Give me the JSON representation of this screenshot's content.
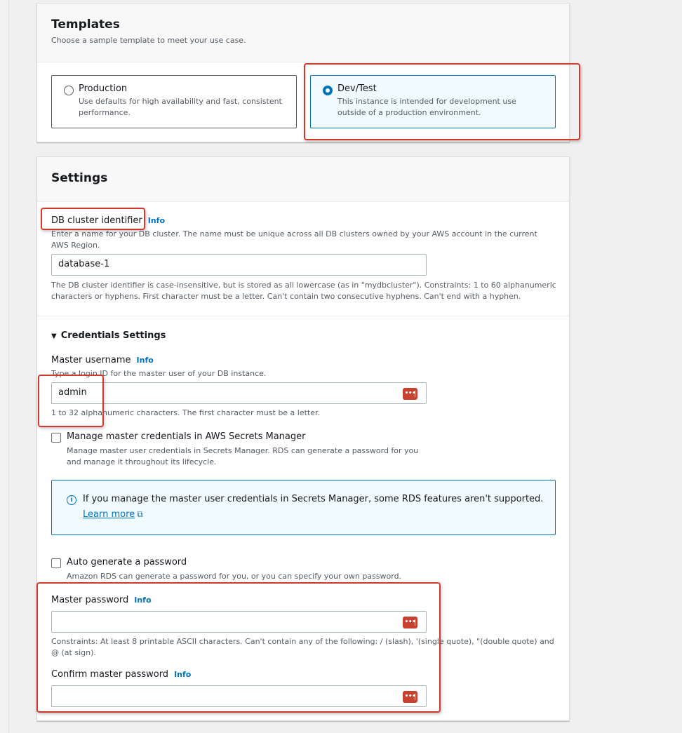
{
  "templates": {
    "title": "Templates",
    "description": "Choose a sample template to meet your use case.",
    "options": [
      {
        "label": "Production",
        "description": "Use defaults for high availability and fast, consistent performance.",
        "selected": false
      },
      {
        "label": "Dev/Test",
        "description": "This instance is intended for development use outside of a production environment.",
        "selected": true
      }
    ]
  },
  "settings": {
    "title": "Settings",
    "db_cluster_identifier": {
      "label": "DB cluster identifier",
      "info": "Info",
      "description": "Enter a name for your DB cluster. The name must be unique across all DB clusters owned by your AWS account in the current AWS Region.",
      "value": "database-1",
      "constraint": "The DB cluster identifier is case-insensitive, but is stored as all lowercase (as in \"mydbcluster\"). Constraints: 1 to 60 alphanumeric characters or hyphens. First character must be a letter. Can't contain two consecutive hyphens. Can't end with a hyphen."
    },
    "credentials": {
      "section_title": "Credentials Settings",
      "master_username": {
        "label": "Master username",
        "info": "Info",
        "description": "Type a login ID for the master user of your DB instance.",
        "value": "admin",
        "constraint": "1 to 32 alphanumeric characters. The first character must be a letter."
      },
      "manage_secrets": {
        "label": "Manage master credentials in AWS Secrets Manager",
        "description": "Manage master user credentials in Secrets Manager. RDS can generate a password for you and manage it throughout its lifecycle.",
        "checked": false
      },
      "alert": {
        "text": "If you manage the master user credentials in Secrets Manager, some RDS features aren't supported.",
        "link": "Learn more"
      },
      "auto_generate": {
        "label": "Auto generate a password",
        "description": "Amazon RDS can generate a password for you, or you can specify your own password.",
        "checked": false
      },
      "master_password": {
        "label": "Master password",
        "info": "Info",
        "value": "",
        "constraint": "Constraints: At least 8 printable ASCII characters. Can't contain any of the following: / (slash), '(single quote), \"(double quote) and @ (at sign)."
      },
      "confirm_password": {
        "label": "Confirm master password",
        "info": "Info",
        "value": ""
      }
    }
  },
  "icons": {
    "password_manager": "•••",
    "info_circle": "i",
    "external_link": "⧉",
    "caret_down": "▼"
  },
  "colors": {
    "accent": "#0073bb",
    "highlight": "#d13a2a",
    "password_icon": "#c8402f"
  }
}
